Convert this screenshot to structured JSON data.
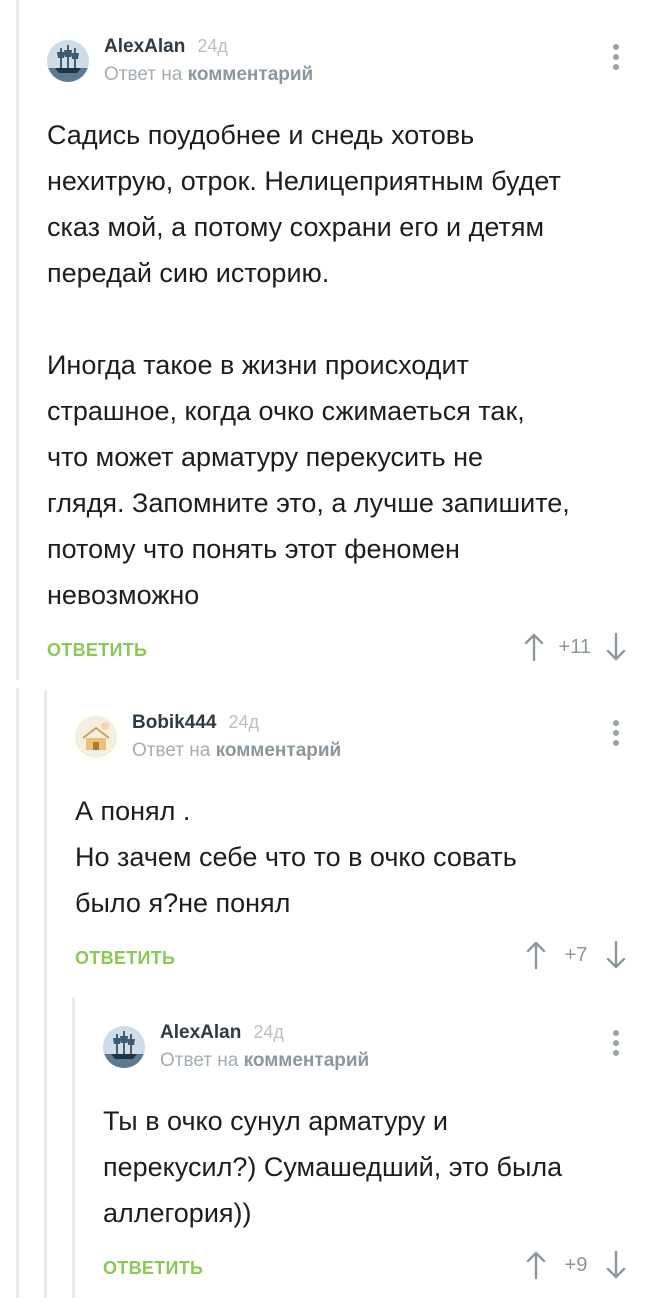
{
  "comments": [
    {
      "username": "AlexAlan",
      "time": "24д",
      "reply_prefix": "Ответ на",
      "reply_target": "комментарий",
      "paragraphs": [
        [
          "Садись поудобнее и снедь хотовь",
          "нехитрую, отрок. Нелицеприятным будет",
          "сказ мой, а потому сохрани его и детям",
          "передай сию историю."
        ],
        [
          "Иногда такое в жизни происходит",
          "страшное, когда очко сжимаеться так,",
          "что может арматуру перекусить не",
          "глядя. Запомните это, а лучше запишите,",
          "потому что понять этот феномен",
          "невозможно"
        ]
      ],
      "reply_label": "ОТВЕТИТЬ",
      "score": "+11",
      "avatar_icon": "ship-avatar-icon"
    },
    {
      "username": "Bobik444",
      "time": "24д",
      "reply_prefix": "Ответ на",
      "reply_target": "комментарий",
      "paragraphs": [
        [
          "А понял .",
          "Но зачем себе что то в очко совать",
          "было я?не понял"
        ]
      ],
      "reply_label": "ОТВЕТИТЬ",
      "score": "+7",
      "avatar_icon": "house-avatar-icon"
    },
    {
      "username": "AlexAlan",
      "time": "24д",
      "reply_prefix": "Ответ на",
      "reply_target": "комментарий",
      "paragraphs": [
        [
          "Ты в очко сунул арматуру и",
          "перекусил?) Сумашедший, это была",
          "аллегория))"
        ]
      ],
      "reply_label": "ОТВЕТИТЬ",
      "score": "+9",
      "avatar_icon": "ship-avatar-icon"
    }
  ],
  "colors": {
    "reply_accent": "#8ac858",
    "thread_line": "#e8ecee",
    "username": "#2e3b45",
    "muted": "#a4adb3"
  }
}
